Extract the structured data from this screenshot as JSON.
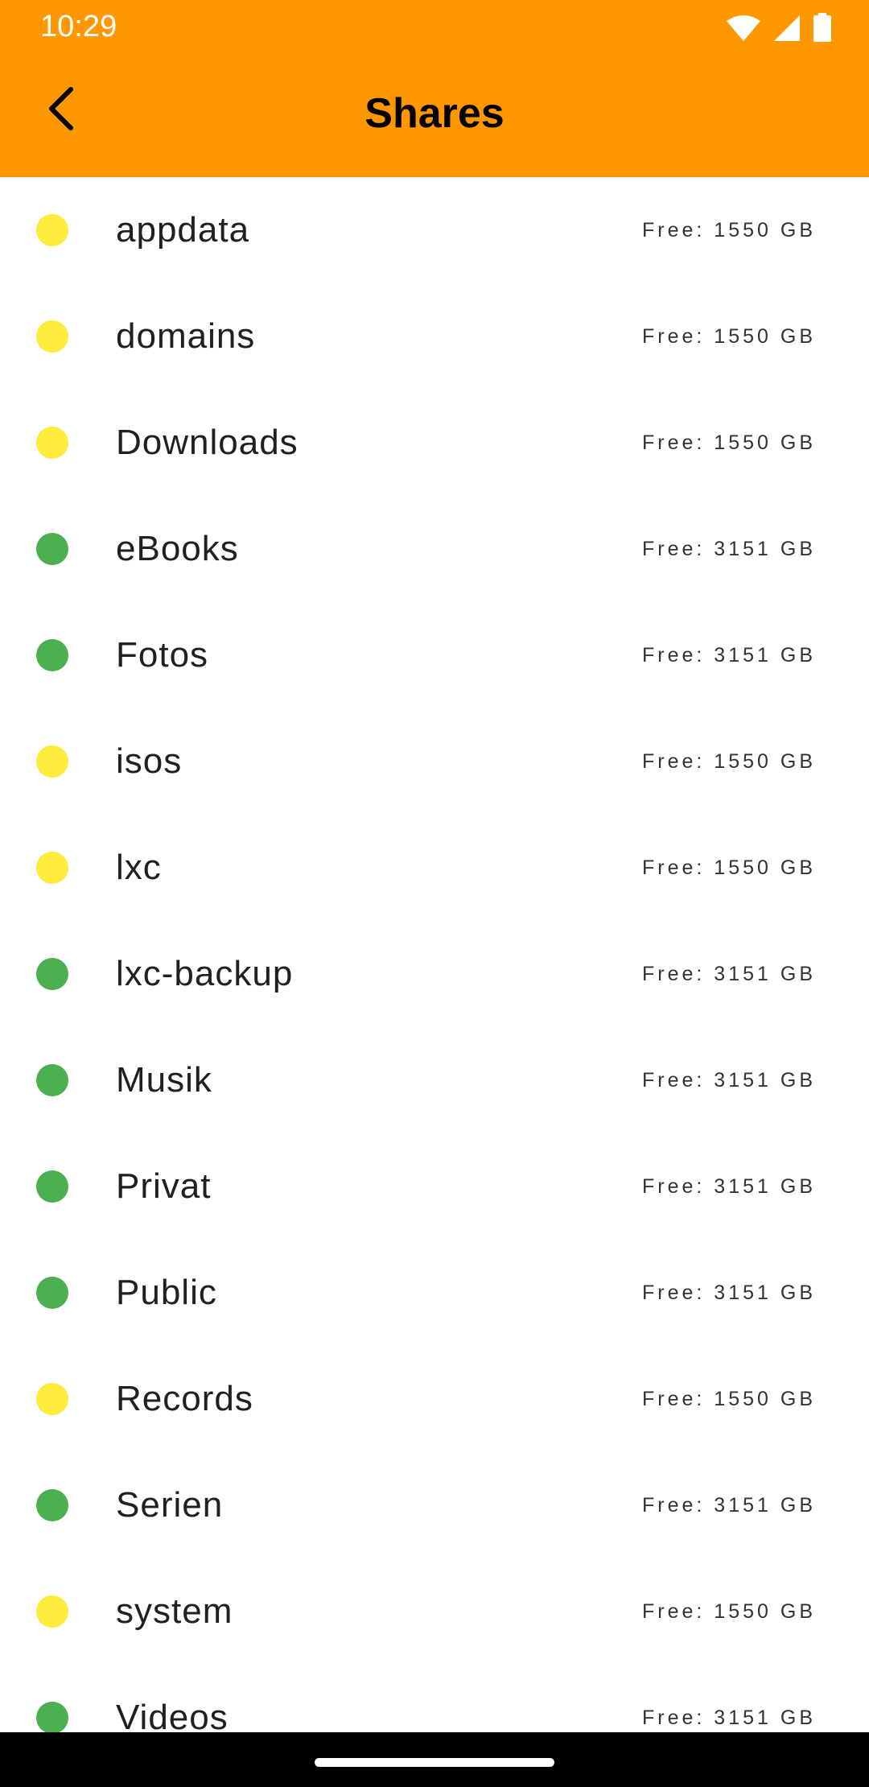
{
  "status_bar": {
    "time": "10:29",
    "icons": [
      "wifi-icon",
      "cellular-signal-icon",
      "battery-icon"
    ]
  },
  "header": {
    "title": "Shares",
    "back_icon": "chevron-left-icon",
    "background_color": "#ff9800"
  },
  "colors": {
    "status_yellow": "#ffeb3b",
    "status_green": "#4caf50"
  },
  "shares": [
    {
      "name": "appdata",
      "free": "Free: 1550 GB",
      "status": "yellow"
    },
    {
      "name": "domains",
      "free": "Free: 1550 GB",
      "status": "yellow"
    },
    {
      "name": "Downloads",
      "free": "Free: 1550 GB",
      "status": "yellow"
    },
    {
      "name": "eBooks",
      "free": "Free: 3151 GB",
      "status": "green"
    },
    {
      "name": "Fotos",
      "free": "Free: 3151 GB",
      "status": "green"
    },
    {
      "name": "isos",
      "free": "Free: 1550 GB",
      "status": "yellow"
    },
    {
      "name": "lxc",
      "free": "Free: 1550 GB",
      "status": "yellow"
    },
    {
      "name": "lxc-backup",
      "free": "Free: 3151 GB",
      "status": "green"
    },
    {
      "name": "Musik",
      "free": "Free: 3151 GB",
      "status": "green"
    },
    {
      "name": "Privat",
      "free": "Free: 3151 GB",
      "status": "green"
    },
    {
      "name": "Public",
      "free": "Free: 3151 GB",
      "status": "green"
    },
    {
      "name": "Records",
      "free": "Free: 1550 GB",
      "status": "yellow"
    },
    {
      "name": "Serien",
      "free": "Free: 3151 GB",
      "status": "green"
    },
    {
      "name": "system",
      "free": "Free: 1550 GB",
      "status": "yellow"
    },
    {
      "name": "Videos",
      "free": "Free: 3151 GB",
      "status": "green"
    }
  ]
}
